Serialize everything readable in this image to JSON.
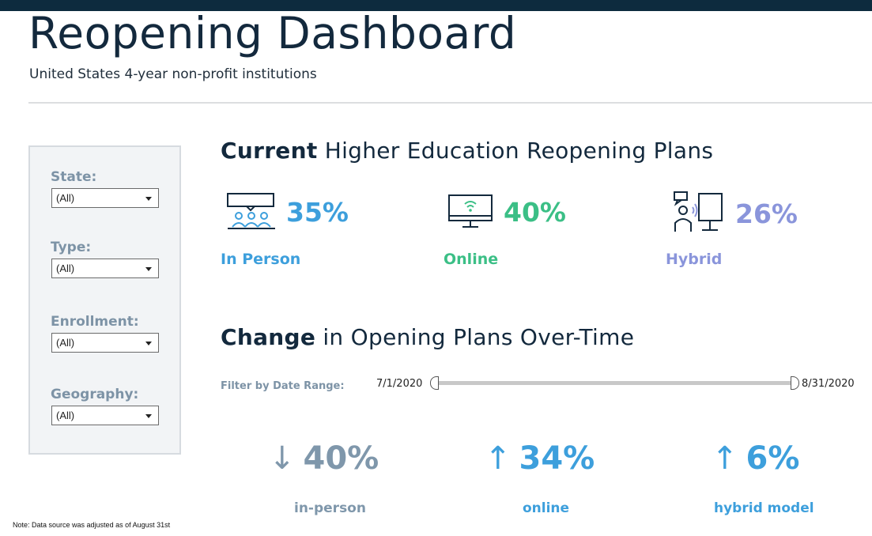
{
  "header": {
    "title": "Reopening Dashboard",
    "subtitle": "United States 4-year non-profit institutions"
  },
  "filters": [
    {
      "label": "State:",
      "value": "(All)"
    },
    {
      "label": "Type:",
      "value": "(All)"
    },
    {
      "label": "Enrollment:",
      "value": "(All)"
    },
    {
      "label": "Geography:",
      "value": "(All)"
    }
  ],
  "current": {
    "title_bold": "Current",
    "title_rest": " Higher Education Reopening Plans",
    "plans": [
      {
        "pct": "35%",
        "label": "In Person",
        "icon": "classroom-icon",
        "color": "#3d9fdc"
      },
      {
        "pct": "40%",
        "label": "Online",
        "icon": "computer-wifi-icon",
        "color": "#3bbf86"
      },
      {
        "pct": "26%",
        "label": "Hybrid",
        "icon": "hybrid-teaching-icon",
        "color": "#8a95db"
      }
    ]
  },
  "change": {
    "title_bold": "Change",
    "title_rest": " in Opening Plans Over-Time",
    "range_label": "Filter by Date Range:",
    "range_start": "7/1/2020",
    "range_end": "8/31/2020",
    "items": [
      {
        "direction": "↓",
        "value": "40%",
        "label": "in-person",
        "color": "#7f97ab"
      },
      {
        "direction": "↑",
        "value": "34%",
        "label": "online",
        "color": "#3d9fdc"
      },
      {
        "direction": "↑",
        "value": "6%",
        "label": "hybrid model",
        "color": "#3d9fdc"
      }
    ]
  },
  "note": "Note: Data source was adjusted as of August 31st",
  "colors": {
    "topbar": "#0d2b3e",
    "title": "#13293d",
    "filter_label": "#7d93a6"
  }
}
